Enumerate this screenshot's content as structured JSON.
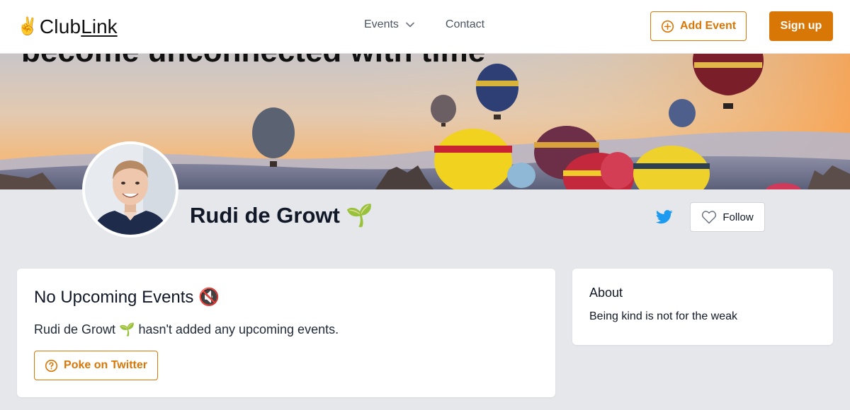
{
  "header": {
    "logo_emoji": "✌️",
    "logo_club": "Club",
    "logo_link": "Link",
    "nav_events": "Events",
    "nav_contact": "Contact",
    "add_event_label": "Add Event",
    "sign_up_label": "Sign up"
  },
  "banner": {
    "caption": "become unconnected with time"
  },
  "profile": {
    "name": "Rudi de Growt 🌱",
    "follow_label": "Follow"
  },
  "events": {
    "title": "No Upcoming Events 🔇",
    "description": "Rudi de Growt 🌱 hasn't added any upcoming events.",
    "poke_label": "Poke on Twitter"
  },
  "about": {
    "title": "About",
    "text": "Being kind is not for the weak"
  },
  "colors": {
    "accent": "#d97706",
    "twitter": "#1d9bf0",
    "background": "#e5e7eb"
  },
  "icons": [
    "plus-circle-icon",
    "chevron-down-icon",
    "twitter-icon",
    "heart-icon",
    "question-circle-icon"
  ]
}
